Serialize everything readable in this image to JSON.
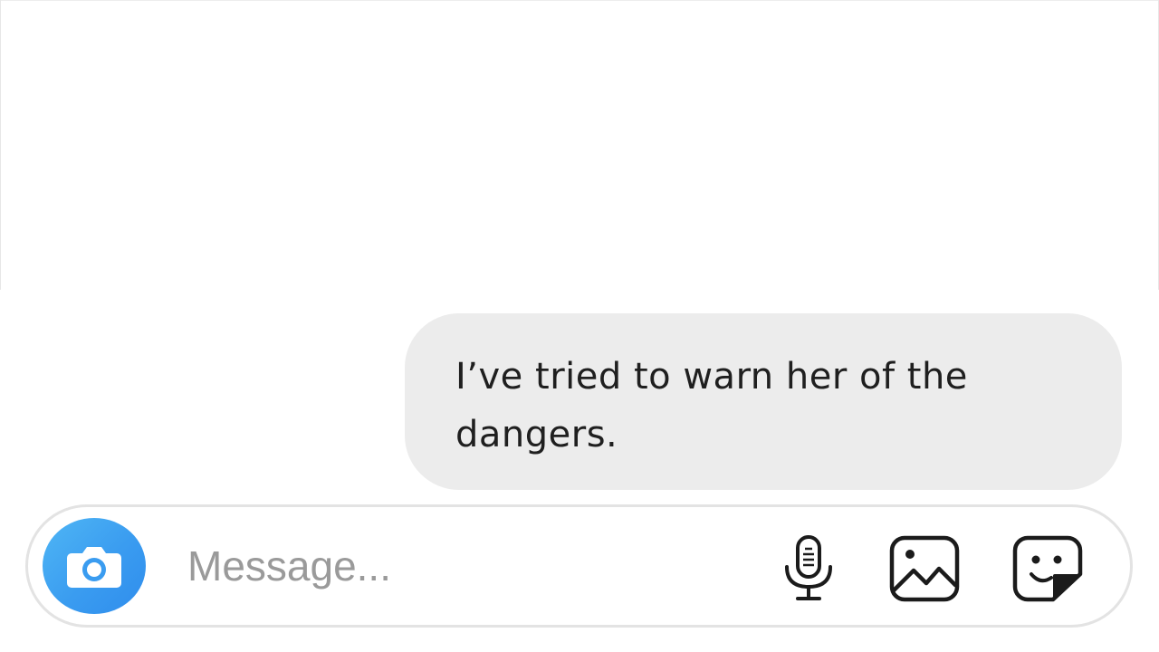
{
  "conversation": {
    "messages": [
      {
        "text": "I’ve tried to warn her of the dangers.",
        "direction": "outgoing"
      }
    ]
  },
  "composer": {
    "placeholder": "Message...",
    "value": "",
    "buttons": {
      "camera_icon": "camera-icon",
      "mic_icon": "microphone-icon",
      "gallery_icon": "image-icon",
      "sticker_icon": "sticker-icon"
    }
  },
  "colors": {
    "camera_button": "#3a9cf0",
    "bubble_background": "#ececec",
    "placeholder_text": "#9a9a9a"
  }
}
